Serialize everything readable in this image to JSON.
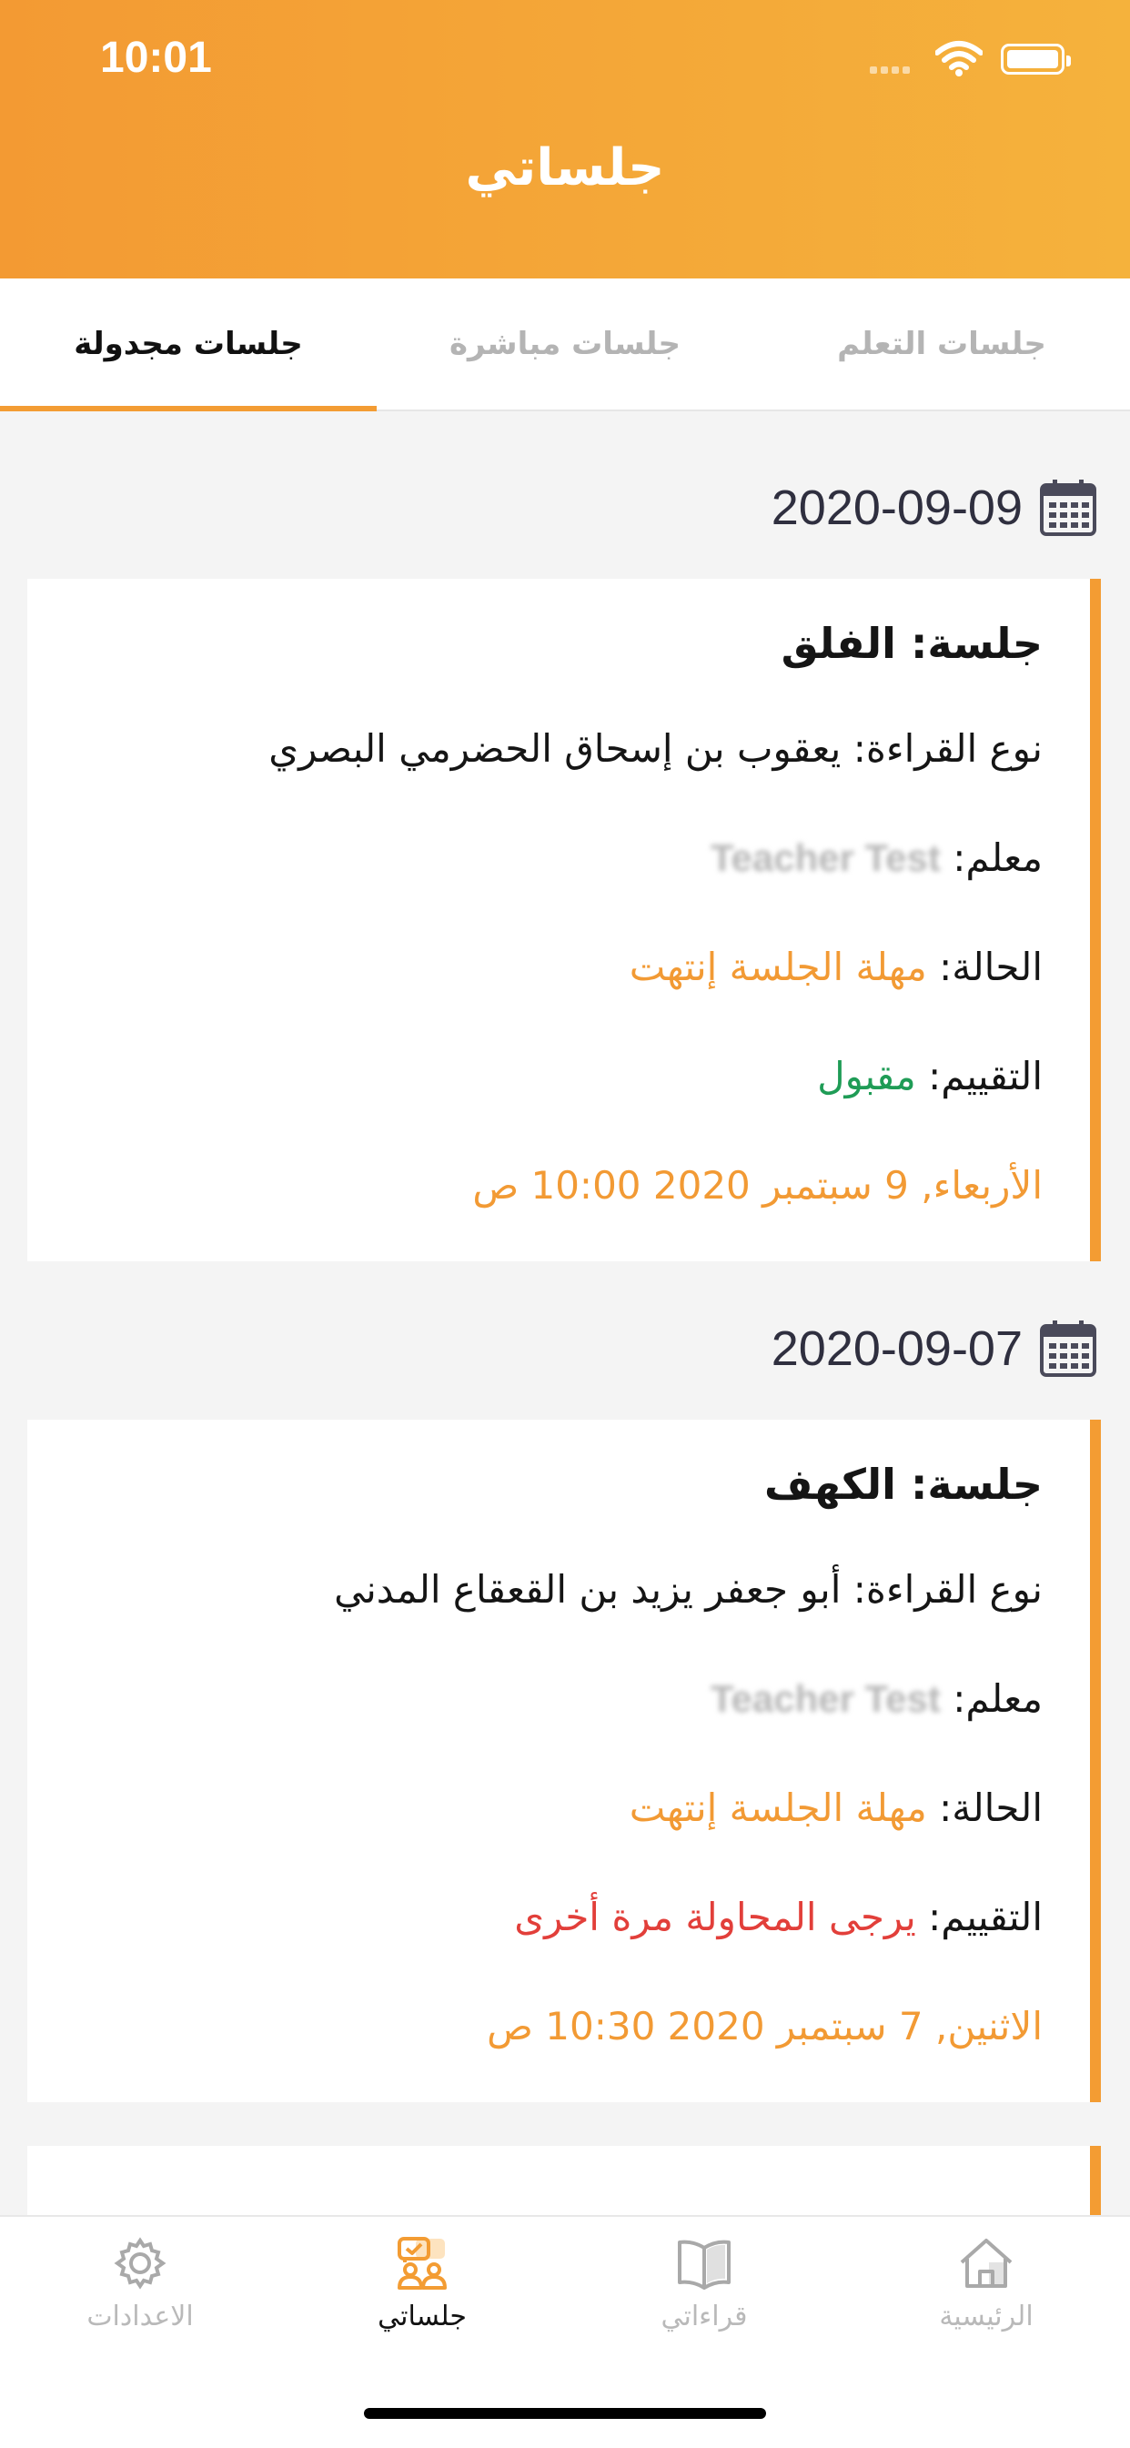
{
  "status_bar": {
    "time": "10:01"
  },
  "header": {
    "title": "جلساتي"
  },
  "tabs": [
    {
      "label": "جلسات التعلم"
    },
    {
      "label": "جلسات مباشرة"
    },
    {
      "label": "جلسات مجدولة"
    }
  ],
  "sessions": [
    {
      "date": "2020-09-09",
      "session_label": "جلسة:",
      "session_value": "الفلق",
      "reading_label": "نوع القراءة:",
      "reading_value": "يعقوب بن إسحاق الحضرمي البصري",
      "teacher_label": "معلم:",
      "teacher_value": "Teacher Test",
      "status_label": "الحالة:",
      "status_value": "مهلة الجلسة إنتهت",
      "rating_label": "التقييم:",
      "rating_value": "مقبول",
      "datetime": "الأربعاء, 9 سبتمبر 2020 10:00 ص"
    },
    {
      "date": "2020-09-07",
      "session_label": "جلسة:",
      "session_value": "الكهف",
      "reading_label": "نوع القراءة:",
      "reading_value": "أبو جعفر يزيد بن القعقاع المدني",
      "teacher_label": "معلم:",
      "teacher_value": "Teacher Test",
      "status_label": "الحالة:",
      "status_value": "مهلة الجلسة إنتهت",
      "rating_label": "التقييم:",
      "rating_value": "يرجى المحاولة مرة أخرى",
      "datetime": "الاثنين, 7 سبتمبر 2020 10:30 ص"
    }
  ],
  "bottom_nav": [
    {
      "label": "الاعدادات",
      "icon": "gear-icon"
    },
    {
      "label": "جلساتي",
      "icon": "sessions-icon"
    },
    {
      "label": "قراءاتي",
      "icon": "book-icon"
    },
    {
      "label": "الرئيسية",
      "icon": "home-icon"
    }
  ],
  "colors": {
    "accent": "#f39c33",
    "accepted": "#1f9c56",
    "retry": "#e23f3a"
  }
}
